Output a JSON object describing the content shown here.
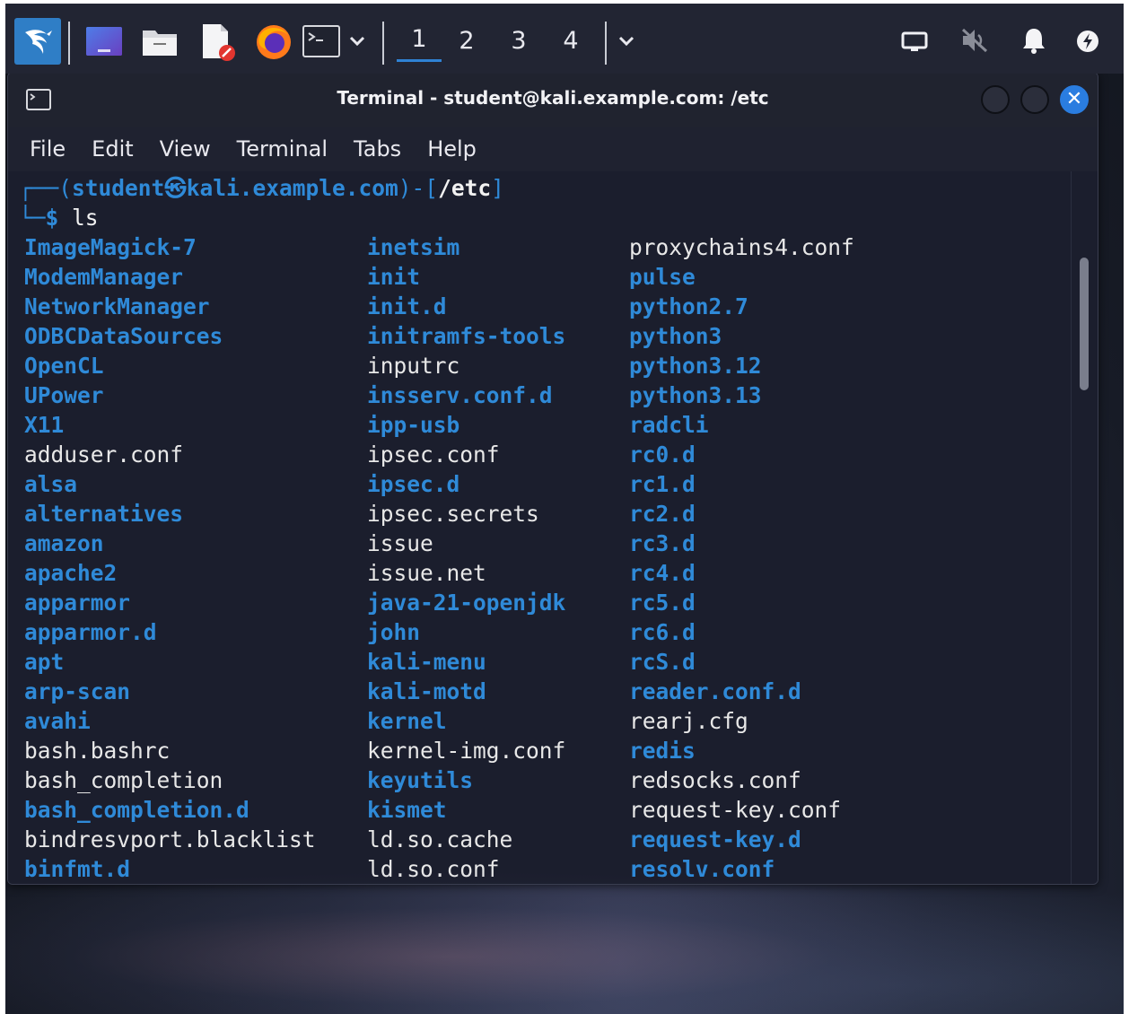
{
  "taskbar": {
    "workspaces": [
      "1",
      "2",
      "3",
      "4"
    ],
    "active_workspace": "1",
    "accent_color": "#2f82d4"
  },
  "window": {
    "title": "Terminal - student@kali.example.com: /etc",
    "menu": [
      "File",
      "Edit",
      "View",
      "Terminal",
      "Tabs",
      "Help"
    ]
  },
  "terminal": {
    "prompt_user": "student",
    "prompt_host": "kali.example.com",
    "prompt_path": "/etc",
    "command": "ls",
    "dir_color": "#2f8ad8",
    "columns": [
      [
        {
          "name": "ImageMagick-7",
          "dir": true
        },
        {
          "name": "ModemManager",
          "dir": true
        },
        {
          "name": "NetworkManager",
          "dir": true
        },
        {
          "name": "ODBCDataSources",
          "dir": true
        },
        {
          "name": "OpenCL",
          "dir": true
        },
        {
          "name": "UPower",
          "dir": true
        },
        {
          "name": "X11",
          "dir": true
        },
        {
          "name": "adduser.conf",
          "dir": false
        },
        {
          "name": "alsa",
          "dir": true
        },
        {
          "name": "alternatives",
          "dir": true
        },
        {
          "name": "amazon",
          "dir": true
        },
        {
          "name": "apache2",
          "dir": true
        },
        {
          "name": "apparmor",
          "dir": true
        },
        {
          "name": "apparmor.d",
          "dir": true
        },
        {
          "name": "apt",
          "dir": true
        },
        {
          "name": "arp-scan",
          "dir": true
        },
        {
          "name": "avahi",
          "dir": true
        },
        {
          "name": "bash.bashrc",
          "dir": false
        },
        {
          "name": "bash_completion",
          "dir": false
        },
        {
          "name": "bash_completion.d",
          "dir": true
        },
        {
          "name": "bindresvport.blacklist",
          "dir": false
        },
        {
          "name": "binfmt.d",
          "dir": true
        }
      ],
      [
        {
          "name": "inetsim",
          "dir": true
        },
        {
          "name": "init",
          "dir": true
        },
        {
          "name": "init.d",
          "dir": true
        },
        {
          "name": "initramfs-tools",
          "dir": true
        },
        {
          "name": "inputrc",
          "dir": false
        },
        {
          "name": "insserv.conf.d",
          "dir": true
        },
        {
          "name": "ipp-usb",
          "dir": true
        },
        {
          "name": "ipsec.conf",
          "dir": false
        },
        {
          "name": "ipsec.d",
          "dir": true
        },
        {
          "name": "ipsec.secrets",
          "dir": false
        },
        {
          "name": "issue",
          "dir": false
        },
        {
          "name": "issue.net",
          "dir": false
        },
        {
          "name": "java-21-openjdk",
          "dir": true
        },
        {
          "name": "john",
          "dir": true
        },
        {
          "name": "kali-menu",
          "dir": true
        },
        {
          "name": "kali-motd",
          "dir": true
        },
        {
          "name": "kernel",
          "dir": true
        },
        {
          "name": "kernel-img.conf",
          "dir": false
        },
        {
          "name": "keyutils",
          "dir": true
        },
        {
          "name": "kismet",
          "dir": true
        },
        {
          "name": "ld.so.cache",
          "dir": false
        },
        {
          "name": "ld.so.conf",
          "dir": false
        }
      ],
      [
        {
          "name": "proxychains4.conf",
          "dir": false
        },
        {
          "name": "pulse",
          "dir": true
        },
        {
          "name": "python2.7",
          "dir": true
        },
        {
          "name": "python3",
          "dir": true
        },
        {
          "name": "python3.12",
          "dir": true
        },
        {
          "name": "python3.13",
          "dir": true
        },
        {
          "name": "radcli",
          "dir": true
        },
        {
          "name": "rc0.d",
          "dir": true
        },
        {
          "name": "rc1.d",
          "dir": true
        },
        {
          "name": "rc2.d",
          "dir": true
        },
        {
          "name": "rc3.d",
          "dir": true
        },
        {
          "name": "rc4.d",
          "dir": true
        },
        {
          "name": "rc5.d",
          "dir": true
        },
        {
          "name": "rc6.d",
          "dir": true
        },
        {
          "name": "rcS.d",
          "dir": true
        },
        {
          "name": "reader.conf.d",
          "dir": true
        },
        {
          "name": "rearj.cfg",
          "dir": false
        },
        {
          "name": "redis",
          "dir": true
        },
        {
          "name": "redsocks.conf",
          "dir": false
        },
        {
          "name": "request-key.conf",
          "dir": false
        },
        {
          "name": "request-key.d",
          "dir": true
        },
        {
          "name": "resolv.conf",
          "dir": true
        }
      ]
    ]
  }
}
